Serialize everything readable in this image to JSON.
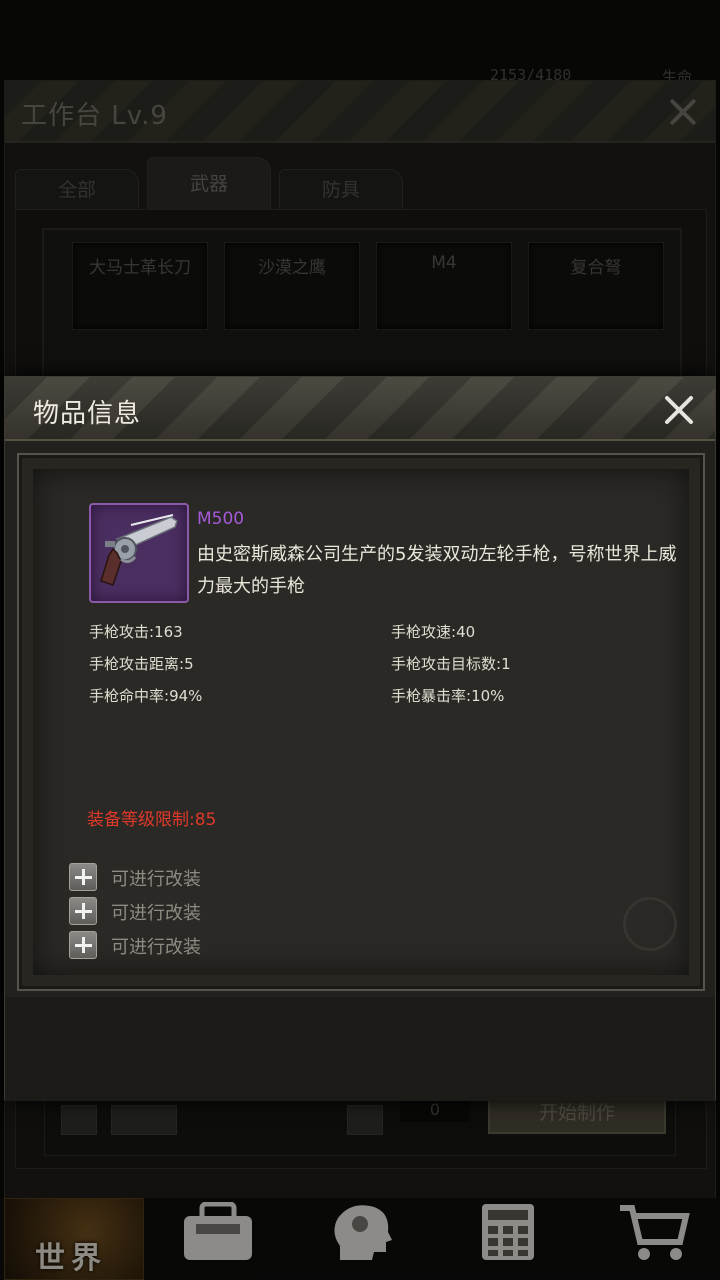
{
  "status_bar": {
    "hp_readout": "2153/4180",
    "hp_label": "生命"
  },
  "workbench": {
    "title": "工作台 Lv.9",
    "tabs": [
      {
        "label": "全部"
      },
      {
        "label": "武器",
        "active": true
      },
      {
        "label": "防具"
      }
    ],
    "recipes": [
      "大马士革长刀",
      "沙漠之鹰",
      "M4",
      "复合弩"
    ],
    "quantity": "0",
    "craft_button": "开始制作"
  },
  "bottom_nav": {
    "world_label": "世界",
    "items": [
      {
        "icon": "globe-icon"
      },
      {
        "icon": "backpack-icon"
      },
      {
        "icon": "head-skill-icon"
      },
      {
        "icon": "calculator-icon"
      },
      {
        "icon": "cart-icon"
      }
    ]
  },
  "item_info": {
    "title": "物品信息",
    "item": {
      "icon": "revolver-icon",
      "rarity_color": "#a559d8",
      "name": "M500",
      "description": "由史密斯威森公司生产的5发装双动左轮手枪，号称世界上威力最大的手枪"
    },
    "stats": [
      {
        "label": "手枪攻击:",
        "value": "163"
      },
      {
        "label": "手枪攻速:",
        "value": "40"
      },
      {
        "label": "手枪攻击距离:",
        "value": "5"
      },
      {
        "label": "手枪攻击目标数:",
        "value": "1"
      },
      {
        "label": "手枪命中率:",
        "value": "94%"
      },
      {
        "label": "手枪暴击率:",
        "value": "10%"
      }
    ],
    "requirement": {
      "label": "装备等级限制:",
      "value": "85",
      "color": "#e0392a"
    },
    "mod_slots": [
      {
        "label": "可进行改装"
      },
      {
        "label": "可进行改装"
      },
      {
        "label": "可进行改装"
      }
    ]
  }
}
